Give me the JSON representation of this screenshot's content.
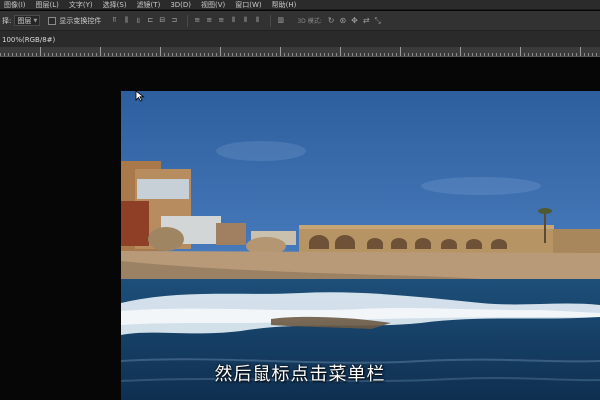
{
  "menu": {
    "items": [
      "图像(I)",
      "图层(L)",
      "文字(Y)",
      "选择(S)",
      "滤镜(T)",
      "3D(D)",
      "视图(V)",
      "窗口(W)",
      "帮助(H)"
    ]
  },
  "options": {
    "select_label": "择:",
    "select_value": "图层",
    "show_transform_label": "显示变换控件",
    "mode_3d_label": "3D 模式:"
  },
  "document": {
    "tab_title": "100%(RGB/8#)"
  },
  "subtitle": "然后鼠标点击菜单栏"
}
